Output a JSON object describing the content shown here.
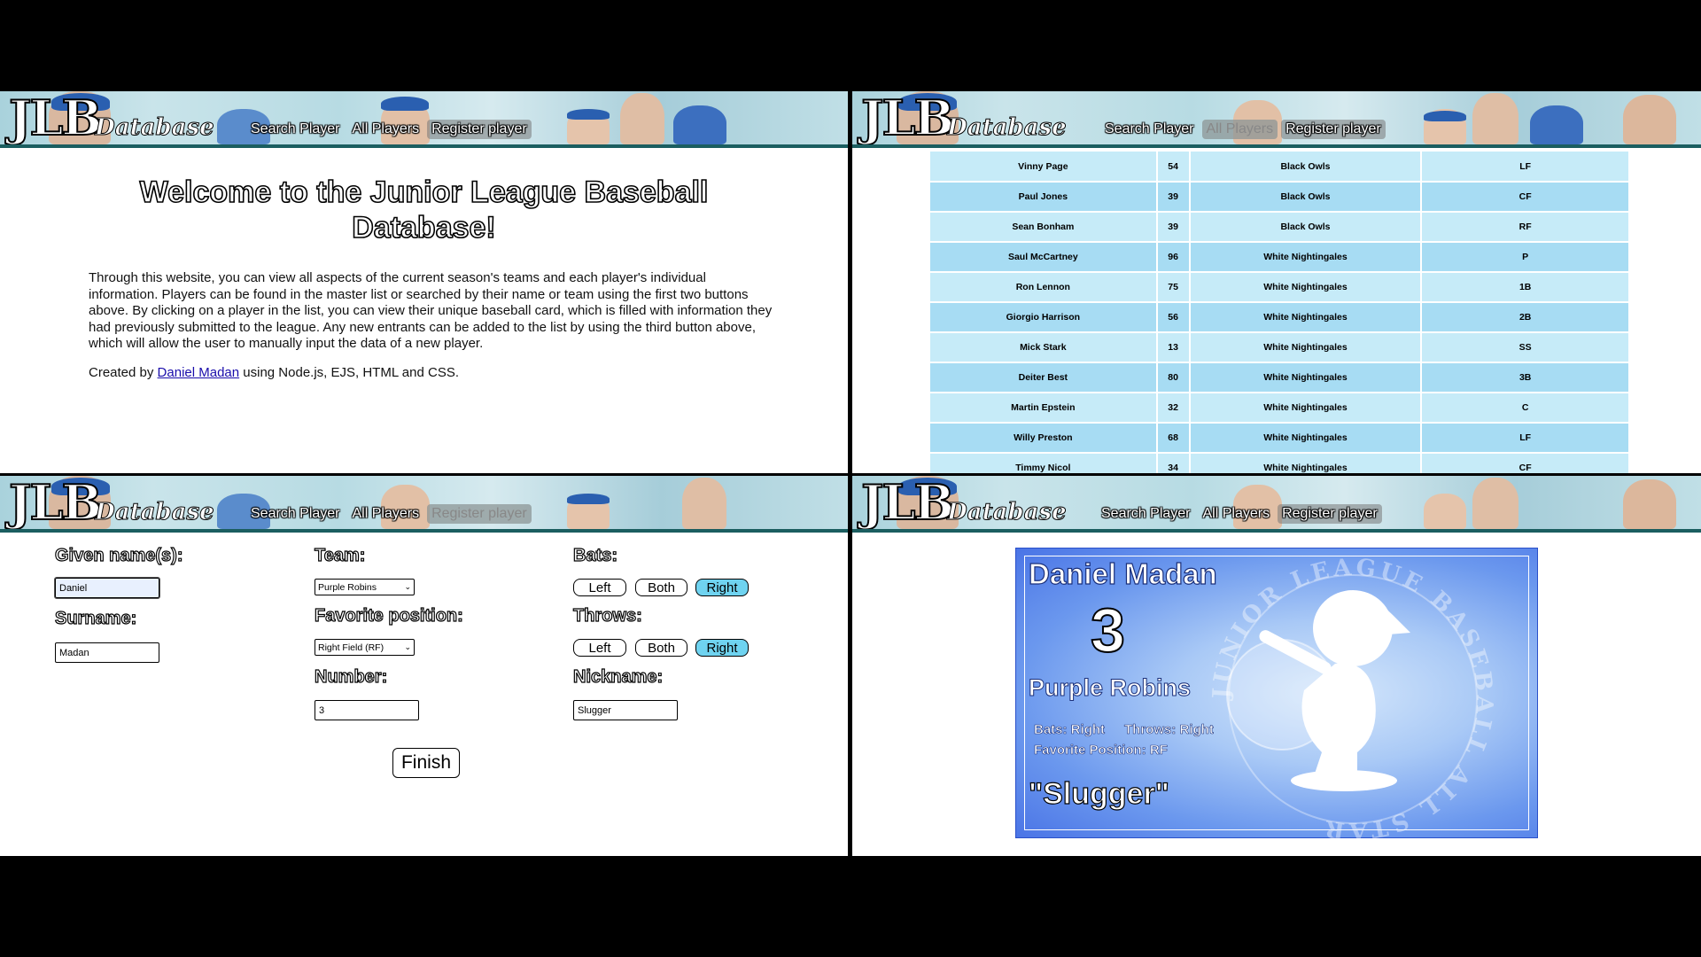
{
  "header": {
    "logo_main": "JLB",
    "logo_sub": "Database",
    "nav": [
      "Search Player",
      "All Players",
      "Register player"
    ]
  },
  "home": {
    "title": "Welcome to the Junior League Baseball Database!",
    "intro": "Through this website, you can view all aspects of the current season's teams and each player's individual information. Players can be found in the master list or searched by their name or team using the first two buttons above. By clicking on a player in the list, you can view their unique baseball card, which is filled with information they had previously submitted to the league. Any new entrants can be added to the list by using the third button above, which will allow the user to manually input the data of a new player.",
    "credit_prefix": "Created by",
    "credit_link": "Daniel Madan",
    "credit_suffix": "using Node.js, EJS, HTML and CSS."
  },
  "players": [
    {
      "name": "Vinny Page",
      "number": "54",
      "team": "Black Owls",
      "position": "LF"
    },
    {
      "name": "Paul Jones",
      "number": "39",
      "team": "Black Owls",
      "position": "CF"
    },
    {
      "name": "Sean Bonham",
      "number": "39",
      "team": "Black Owls",
      "position": "RF"
    },
    {
      "name": "Saul McCartney",
      "number": "96",
      "team": "White Nightingales",
      "position": "P"
    },
    {
      "name": "Ron Lennon",
      "number": "75",
      "team": "White Nightingales",
      "position": "1B"
    },
    {
      "name": "Giorgio Harrison",
      "number": "56",
      "team": "White Nightingales",
      "position": "2B"
    },
    {
      "name": "Mick Stark",
      "number": "13",
      "team": "White Nightingales",
      "position": "SS"
    },
    {
      "name": "Deiter Best",
      "number": "80",
      "team": "White Nightingales",
      "position": "3B"
    },
    {
      "name": "Martin Epstein",
      "number": "32",
      "team": "White Nightingales",
      "position": "C"
    },
    {
      "name": "Willy Preston",
      "number": "68",
      "team": "White Nightingales",
      "position": "LF"
    },
    {
      "name": "Timmy Nicol",
      "number": "34",
      "team": "White Nightingales",
      "position": "CF"
    }
  ],
  "register": {
    "given_label": "Given name(s):",
    "given_value": "Daniel",
    "surname_label": "Surname:",
    "surname_value": "Madan",
    "team_label": "Team:",
    "team_value": "Purple Robins",
    "position_label": "Favorite position:",
    "position_value": "Right Field (RF)",
    "number_label": "Number:",
    "number_value": "3",
    "bats_label": "Bats:",
    "throws_label": "Throws:",
    "nickname_label": "Nickname:",
    "nickname_value": "Slugger",
    "options": [
      "Left",
      "Both",
      "Right"
    ],
    "bats_selected": "Right",
    "throws_selected": "Right",
    "finish_label": "Finish"
  },
  "card": {
    "name": "Daniel Madan",
    "number": "3",
    "team": "Purple Robins",
    "bats": "Bats: Right",
    "throws": "Throws: Right",
    "favorite_position": "Favorite Position: RF",
    "nickname": "\"Slugger\"",
    "watermark": "JUNIOR LEAGUE BASEBALL ALL STAR"
  },
  "colors": {
    "header_border": "#1b5e60",
    "row_light": "#c6ebf8",
    "row_dark": "#a7dcf3",
    "toggle_on": "#6fd3f0",
    "card_blue": "#4a74e6"
  }
}
